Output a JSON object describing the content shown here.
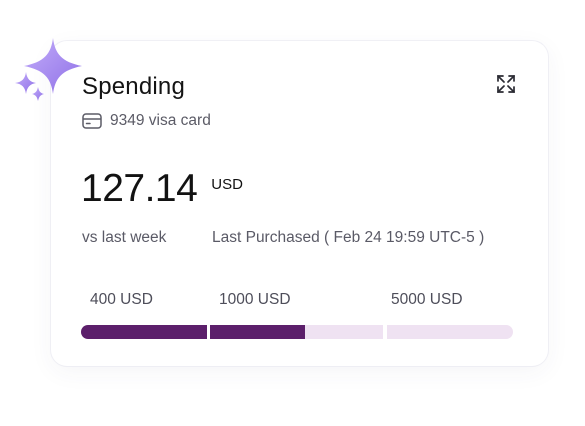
{
  "widget": {
    "title": "Spending",
    "card_label": "9349 visa card",
    "amount": "127.14",
    "currency": "USD",
    "comparison": "vs last week",
    "last_purchased": "Last Purchased ( Feb 24 19:59 UTC-5 )"
  },
  "limits": {
    "tick_1": "400 USD",
    "tick_2": "1000 USD",
    "tick_3": "5000 USD",
    "segment_fill_fractions": [
      1.0,
      0.55,
      0.0
    ]
  },
  "colors": {
    "bar_filled": "#5c1f6b",
    "bar_empty": "#efe2f2",
    "sparkle": "#a58bf2"
  },
  "icons": {
    "decoration": "sparkle-icon",
    "expand": "expand-icon",
    "card": "credit-card-icon"
  }
}
